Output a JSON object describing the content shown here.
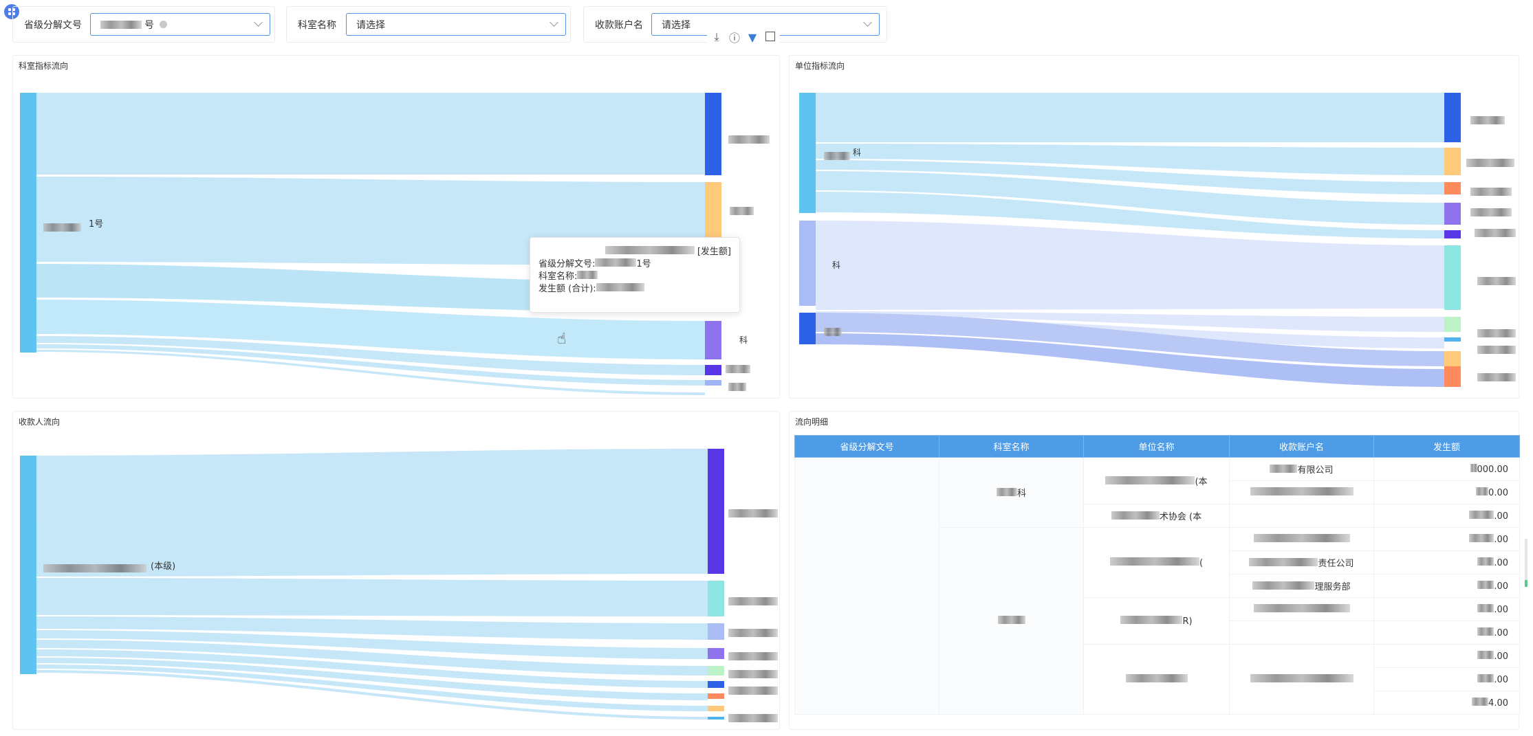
{
  "filters": [
    {
      "label": "省级分解文号",
      "value": "号"
    },
    {
      "label": "科室名称",
      "value": "请选择"
    },
    {
      "label": "收款账户名",
      "value": "请选择"
    }
  ],
  "toolbar": {
    "download_icon": "download-icon",
    "info_icon": "info-icon",
    "filter_icon": "filter-icon",
    "fullscreen_icon": "fullscreen-icon"
  },
  "panels": {
    "dept": {
      "title": "科室指标流向",
      "source_label": "1号",
      "target_labels": [
        "",
        "",
        "科"
      ]
    },
    "unit": {
      "title": "单位指标流向",
      "source_labels": [
        "科",
        "科",
        ""
      ]
    },
    "payee": {
      "title": "收款人流向",
      "source_label": "(本级)",
      "target_labels": [
        "",
        "",
        "",
        "",
        "",
        ""
      ]
    },
    "detail": {
      "title": "流向明细"
    }
  },
  "tooltip": {
    "header": "[发生额]",
    "rows": [
      {
        "label": "省级分解文号:",
        "value": "1号"
      },
      {
        "label": "科室名称:",
        "value": ""
      },
      {
        "label": "发生额 (合计):",
        "value": ""
      }
    ]
  },
  "table": {
    "headers": [
      "省级分解文号",
      "科室名称",
      "单位名称",
      "收款账户名",
      "发生额"
    ],
    "rows": [
      {
        "dept": "科",
        "unit": "(本",
        "payee": "有限公司",
        "amount": "000.00"
      },
      {
        "dept": "",
        "unit": "",
        "payee": "",
        "amount": "0.00"
      },
      {
        "dept": "",
        "unit": "术协会 (本",
        "payee": "",
        "amount": ".00"
      },
      {
        "dept": "",
        "unit": "",
        "payee": "",
        "amount": ".00"
      },
      {
        "dept": "",
        "unit": "(",
        "payee": "",
        "amount": ".00"
      },
      {
        "dept": "",
        "unit": "",
        "payee": "责任公司",
        "amount": ".00"
      },
      {
        "dept": "",
        "unit": "",
        "payee": "理服务部",
        "amount": ".00"
      },
      {
        "dept": "",
        "unit": "R)",
        "payee": "",
        "amount": ".00"
      },
      {
        "dept": "",
        "unit": "",
        "payee": "",
        "amount": ".00"
      },
      {
        "dept": "",
        "unit": "",
        "payee": "",
        "amount": ".00"
      },
      {
        "dept": "",
        "unit": "",
        "payee": "",
        "amount": "4.00"
      }
    ]
  },
  "colors": {
    "link": "#c4e6f8",
    "source_node": "#5fc3f0",
    "blue": "#2d61e6",
    "orange": "#ffc97a",
    "purple": "#8f72ee",
    "violet": "#5a37e6",
    "teal": "#8de6e1",
    "coral": "#ff8a5c",
    "green": "#bdf2c8"
  }
}
